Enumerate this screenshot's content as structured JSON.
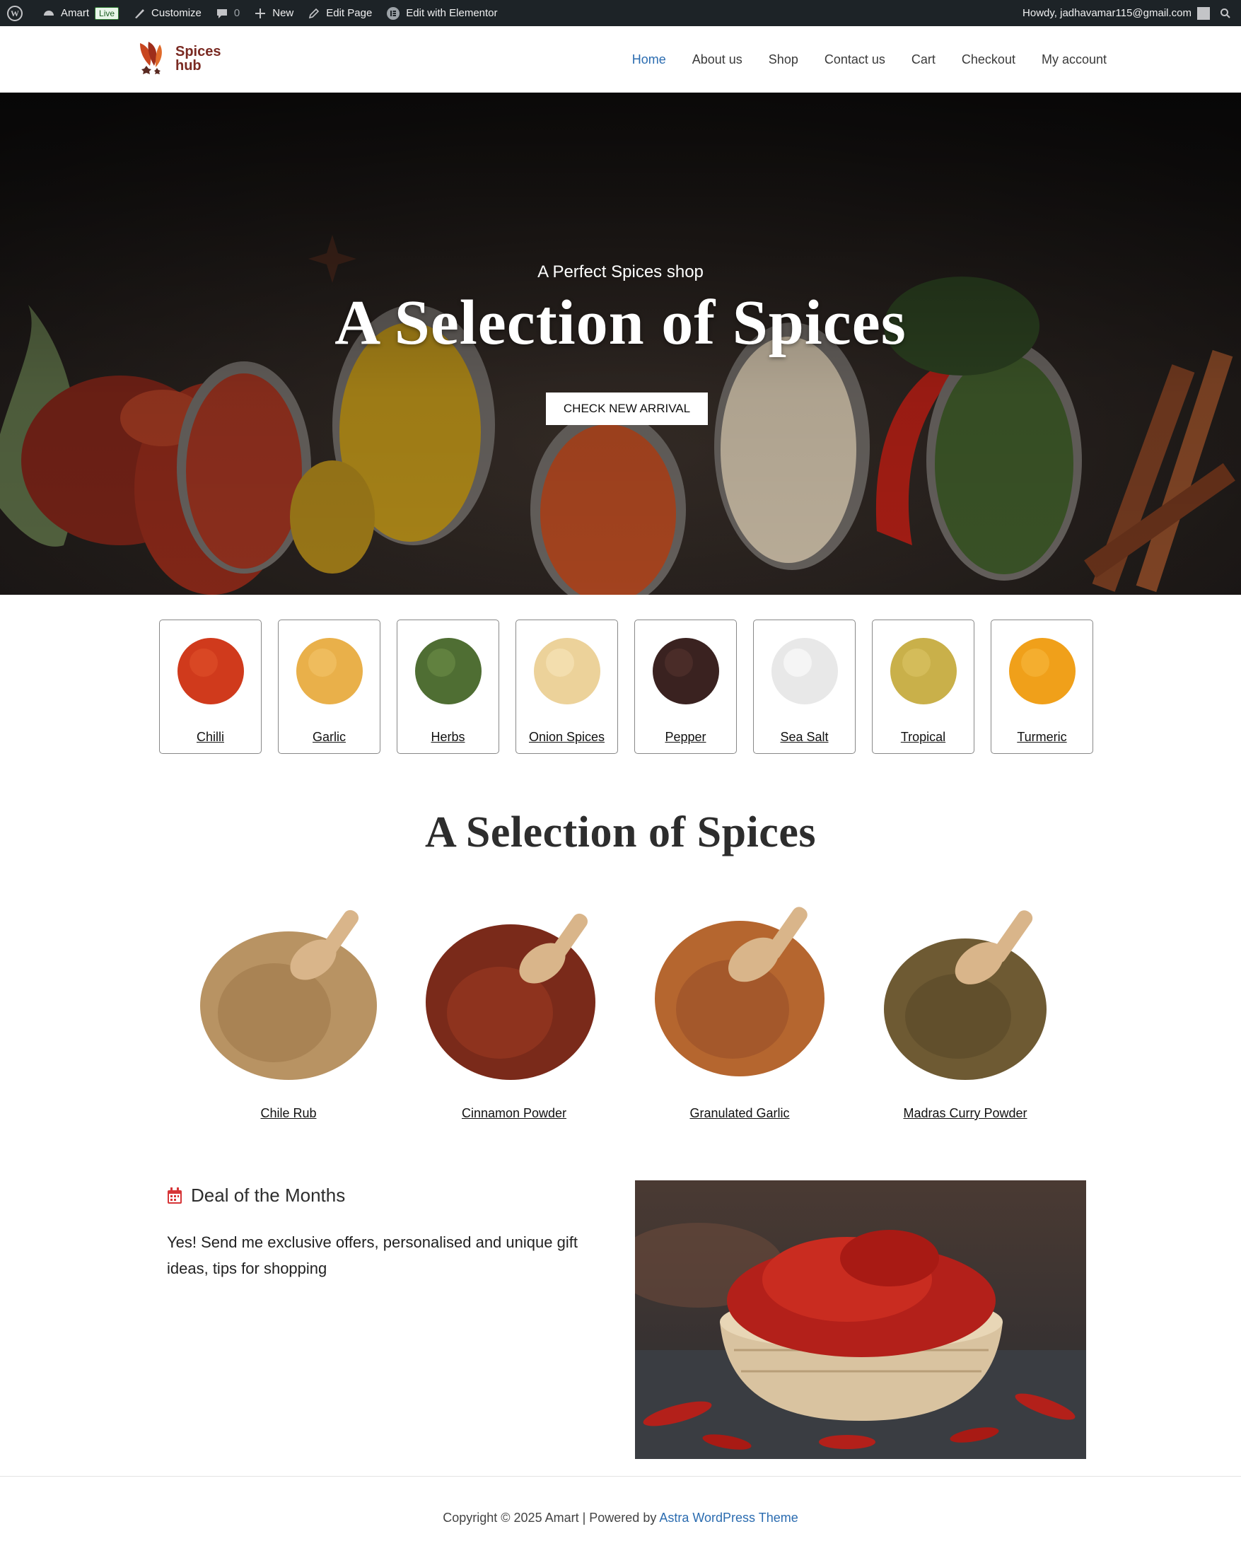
{
  "adminbar": {
    "site_name": "Amart",
    "live_badge": "Live",
    "customize": "Customize",
    "comments_count": "0",
    "new": "New",
    "edit_page": "Edit Page",
    "edit_elementor": "Edit with Elementor",
    "howdy": "Howdy, jadhavamar115@gmail.com"
  },
  "header": {
    "logo_line1": "Spices",
    "logo_line2": "hub",
    "nav": [
      "Home",
      "About us",
      "Shop",
      "Contact us",
      "Cart",
      "Checkout",
      "My account"
    ],
    "active_nav": "Home"
  },
  "hero": {
    "subtitle": "A Perfect Spices shop",
    "title": "A Selection of Spices",
    "button": "CHECK NEW ARRIVAL"
  },
  "categories": [
    {
      "label": "Chilli",
      "color": "#d03a1c"
    },
    {
      "label": "Garlic",
      "color": "#e9b04a"
    },
    {
      "label": "Herbs",
      "color": "#4f6e33"
    },
    {
      "label": "Onion Spices",
      "color": "#ecd29a"
    },
    {
      "label": "Pepper",
      "color": "#3a2220"
    },
    {
      "label": "Sea Salt",
      "color": "#e8e8e8"
    },
    {
      "label": "Tropical",
      "color": "#c9b04a"
    },
    {
      "label": "Turmeric",
      "color": "#f0a01a"
    }
  ],
  "section_title": "A Selection of Spices",
  "products": [
    {
      "label": "Chile Rub",
      "color": "#b89363"
    },
    {
      "label": "Cinnamon Powder",
      "color": "#7a2a1a"
    },
    {
      "label": "Granulated Garlic",
      "color": "#b5662f"
    },
    {
      "label": "Madras Curry Powder",
      "color": "#6e5a33"
    }
  ],
  "deal": {
    "title": "Deal of the Months",
    "text": "Yes! Send me exclusive offers, personalised and unique gift ideas, tips for shopping"
  },
  "footer": {
    "copyright": "Copyright © 2025 Amart | Powered by ",
    "theme_link": "Astra WordPress Theme"
  },
  "colors": {
    "adminbar_bg": "#1d2327",
    "nav_active": "#2b6cb0",
    "deal_icon": "#d63638"
  }
}
